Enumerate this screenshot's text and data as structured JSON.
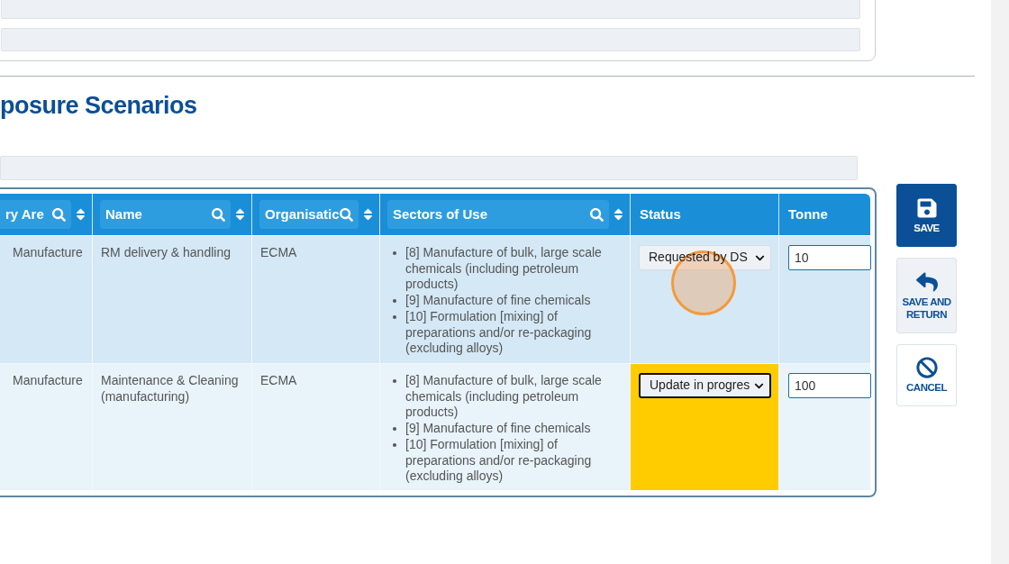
{
  "section": {
    "title": "posure Scenarios"
  },
  "table": {
    "columns": [
      {
        "label": "ry Are",
        "filterable": true
      },
      {
        "label": "Name",
        "filterable": true
      },
      {
        "label": "Organisatic",
        "filterable": true
      },
      {
        "label": "Sectors of Use",
        "filterable": true
      },
      {
        "label": "Status",
        "filterable": false
      },
      {
        "label": "Tonne",
        "filterable": false
      }
    ],
    "rows": [
      {
        "area": "Manufacture",
        "name": "RM delivery & handling",
        "organisation": "ECMA",
        "sectors": [
          "[8] Manufacture of bulk, large scale chemicals (including petroleum products)",
          "[9] Manufacture of fine chemicals",
          "[10] Formulation [mixing] of preparations and/or re-packaging (excluding alloys)"
        ],
        "status": "Requested by DS",
        "status_highlighted": false,
        "status_focused": false,
        "tonnes": "10"
      },
      {
        "area": "Manufacture",
        "name": "Maintenance & Cleaning (manufacturing)",
        "organisation": "ECMA",
        "sectors": [
          "[8] Manufacture of bulk, large scale chemicals (including petroleum products)",
          "[9] Manufacture of fine chemicals",
          "[10] Formulation [mixing] of preparations and/or re-packaging (excluding alloys)"
        ],
        "status": "Update in progres",
        "status_highlighted": true,
        "status_focused": true,
        "tonnes": "100"
      }
    ]
  },
  "actions": [
    {
      "kind": "save",
      "label": "SAVE"
    },
    {
      "kind": "return",
      "label": "SAVE AND RETURN"
    },
    {
      "kind": "cancel",
      "label": "CANCEL"
    }
  ]
}
